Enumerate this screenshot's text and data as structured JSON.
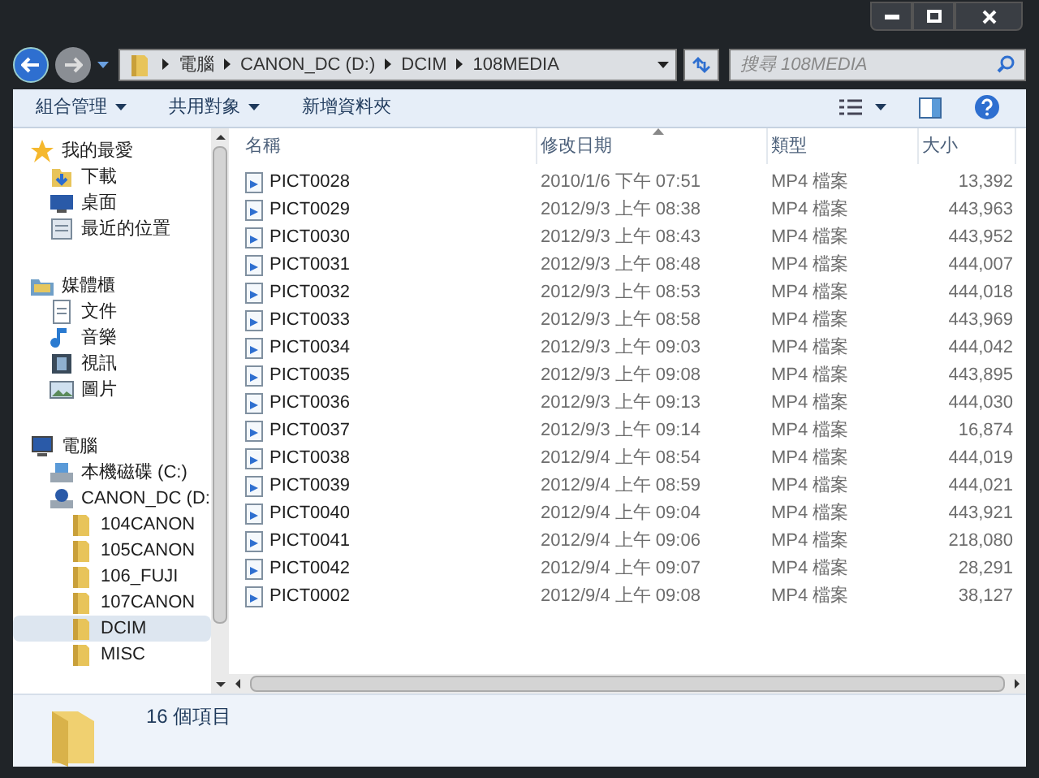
{
  "address_bar": {
    "segments": [
      "電腦",
      "CANON_DC (D:)",
      "DCIM",
      "108MEDIA"
    ]
  },
  "search": {
    "placeholder": "搜尋 108MEDIA"
  },
  "toolbar": [
    {
      "label": "組合管理",
      "dropdown": true
    },
    {
      "label": "共用對象",
      "dropdown": true
    },
    {
      "label": "新增資料夾",
      "dropdown": false
    }
  ],
  "sidebar": [
    {
      "label": "我的最愛",
      "kind": "star",
      "selected": false,
      "children": [
        {
          "label": "下載",
          "kind": "download",
          "selected": false
        },
        {
          "label": "桌面",
          "kind": "desktop",
          "selected": false
        },
        {
          "label": "最近的位置",
          "kind": "recent",
          "selected": false
        }
      ]
    },
    {
      "label": "媒體櫃",
      "kind": "library",
      "selected": false,
      "children": [
        {
          "label": "文件",
          "kind": "document",
          "selected": false
        },
        {
          "label": "音樂",
          "kind": "music",
          "selected": false
        },
        {
          "label": "視訊",
          "kind": "video",
          "selected": false
        },
        {
          "label": "圖片",
          "kind": "picture",
          "selected": false
        }
      ]
    },
    {
      "label": "電腦",
      "kind": "computer",
      "selected": false,
      "children": [
        {
          "label": "本機磁碟 (C:)",
          "kind": "drive",
          "selected": false
        },
        {
          "label": "CANON_DC (D:",
          "kind": "camera",
          "selected": false,
          "children": [
            {
              "label": "104CANON",
              "kind": "folder",
              "selected": false
            },
            {
              "label": "105CANON",
              "kind": "folder",
              "selected": false
            },
            {
              "label": "106_FUJI",
              "kind": "folder",
              "selected": false
            },
            {
              "label": "107CANON",
              "kind": "folder",
              "selected": false
            },
            {
              "label": "DCIM",
              "kind": "folder",
              "selected": true
            },
            {
              "label": "MISC",
              "kind": "folder",
              "selected": false
            }
          ]
        }
      ]
    }
  ],
  "table": {
    "columns": [
      {
        "label": "名稱",
        "sorted": false
      },
      {
        "label": "修改日期",
        "sorted": true
      },
      {
        "label": "類型",
        "sorted": false
      },
      {
        "label": "大小",
        "sorted": false
      }
    ],
    "rows": [
      [
        "PICT0028",
        "2010/1/6 下午 07:51",
        "MP4 檔案",
        "13,392"
      ],
      [
        "PICT0029",
        "2012/9/3 上午 08:38",
        "MP4 檔案",
        "443,963"
      ],
      [
        "PICT0030",
        "2012/9/3 上午 08:43",
        "MP4 檔案",
        "443,952"
      ],
      [
        "PICT0031",
        "2012/9/3 上午 08:48",
        "MP4 檔案",
        "444,007"
      ],
      [
        "PICT0032",
        "2012/9/3 上午 08:53",
        "MP4 檔案",
        "444,018"
      ],
      [
        "PICT0033",
        "2012/9/3 上午 08:58",
        "MP4 檔案",
        "443,969"
      ],
      [
        "PICT0034",
        "2012/9/3 上午 09:03",
        "MP4 檔案",
        "444,042"
      ],
      [
        "PICT0035",
        "2012/9/3 上午 09:08",
        "MP4 檔案",
        "443,895"
      ],
      [
        "PICT0036",
        "2012/9/3 上午 09:13",
        "MP4 檔案",
        "444,030"
      ],
      [
        "PICT0037",
        "2012/9/3 上午 09:14",
        "MP4 檔案",
        "16,874"
      ],
      [
        "PICT0038",
        "2012/9/4 上午 08:54",
        "MP4 檔案",
        "444,019"
      ],
      [
        "PICT0039",
        "2012/9/4 上午 08:59",
        "MP4 檔案",
        "444,021"
      ],
      [
        "PICT0040",
        "2012/9/4 上午 09:04",
        "MP4 檔案",
        "443,921"
      ],
      [
        "PICT0041",
        "2012/9/4 上午 09:06",
        "MP4 檔案",
        "218,080"
      ],
      [
        "PICT0042",
        "2012/9/4 上午 09:07",
        "MP4 檔案",
        "28,291"
      ],
      [
        "PICT0002",
        "2012/9/4 上午 09:08",
        "MP4 檔案",
        "38,127"
      ]
    ]
  },
  "status_bar": {
    "text": "16 個項目"
  }
}
